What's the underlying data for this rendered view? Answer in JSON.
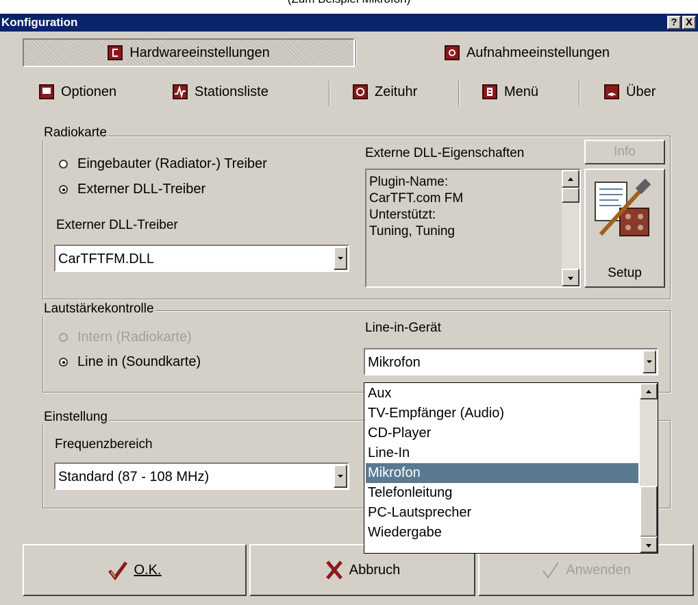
{
  "caption": "(Zum Beispiel Mikrofon)",
  "window": {
    "title": "Konfiguration",
    "help_label": "?",
    "close_label": "X"
  },
  "tabs_main": [
    {
      "label": "Hardwareeinstellungen",
      "icon": "hardware-icon",
      "active": true
    },
    {
      "label": "Aufnahmeeinstellungen",
      "icon": "record-icon",
      "active": false
    }
  ],
  "tabs_sub": [
    {
      "label": "Optionen",
      "icon": "monitor-icon"
    },
    {
      "label": "Stationsliste",
      "icon": "pulse-icon"
    },
    {
      "label": "Zeituhr",
      "icon": "clock-icon"
    },
    {
      "label": "Menü",
      "icon": "menu-icon"
    },
    {
      "label": "Über",
      "icon": "signal-icon"
    }
  ],
  "radiokarte": {
    "label": "Radiokarte",
    "option_internal": "Eingebauter (Radiator-) Treiber",
    "option_external": "Externer DLL-Treiber",
    "selected": "external",
    "driver_label": "Externer DLL-Treiber",
    "driver_value": "CarTFTFM.DLL",
    "dll_props_label": "Externe DLL-Eigenschaften",
    "info_button": "Info",
    "setup_button": "Setup",
    "dll_props_lines": [
      "Plugin-Name:",
      "CarTFT.com FM",
      "Unterstützt:",
      "Tuning, Tuning"
    ]
  },
  "volume": {
    "label": "Lautstärkekontrolle",
    "option_internal": "Intern (Radiokarte)",
    "option_line_in": "Line in (Soundkarte)",
    "selected": "line_in",
    "line_in_device_label": "Line-in-Gerät",
    "line_in_device_value": "Mikrofon",
    "dropdown_options": [
      "Aux",
      "TV-Empfänger (Audio)",
      "CD-Player",
      "Line-In",
      "Mikrofon",
      "Telefonleitung",
      "PC-Lautsprecher",
      "Wiedergabe"
    ],
    "dropdown_selected": "Mikrofon"
  },
  "einstellung": {
    "label": "Einstellung",
    "freq_label": "Frequenzbereich",
    "freq_value": "Standard (87 - 108 MHz)"
  },
  "buttons": {
    "ok": "O.K.",
    "cancel": "Abbruch",
    "apply": "Anwenden"
  },
  "colors": {
    "title_bar": "#0a246a",
    "selection": "#5a7a92",
    "dialog_bg": "#d4d0c8"
  }
}
